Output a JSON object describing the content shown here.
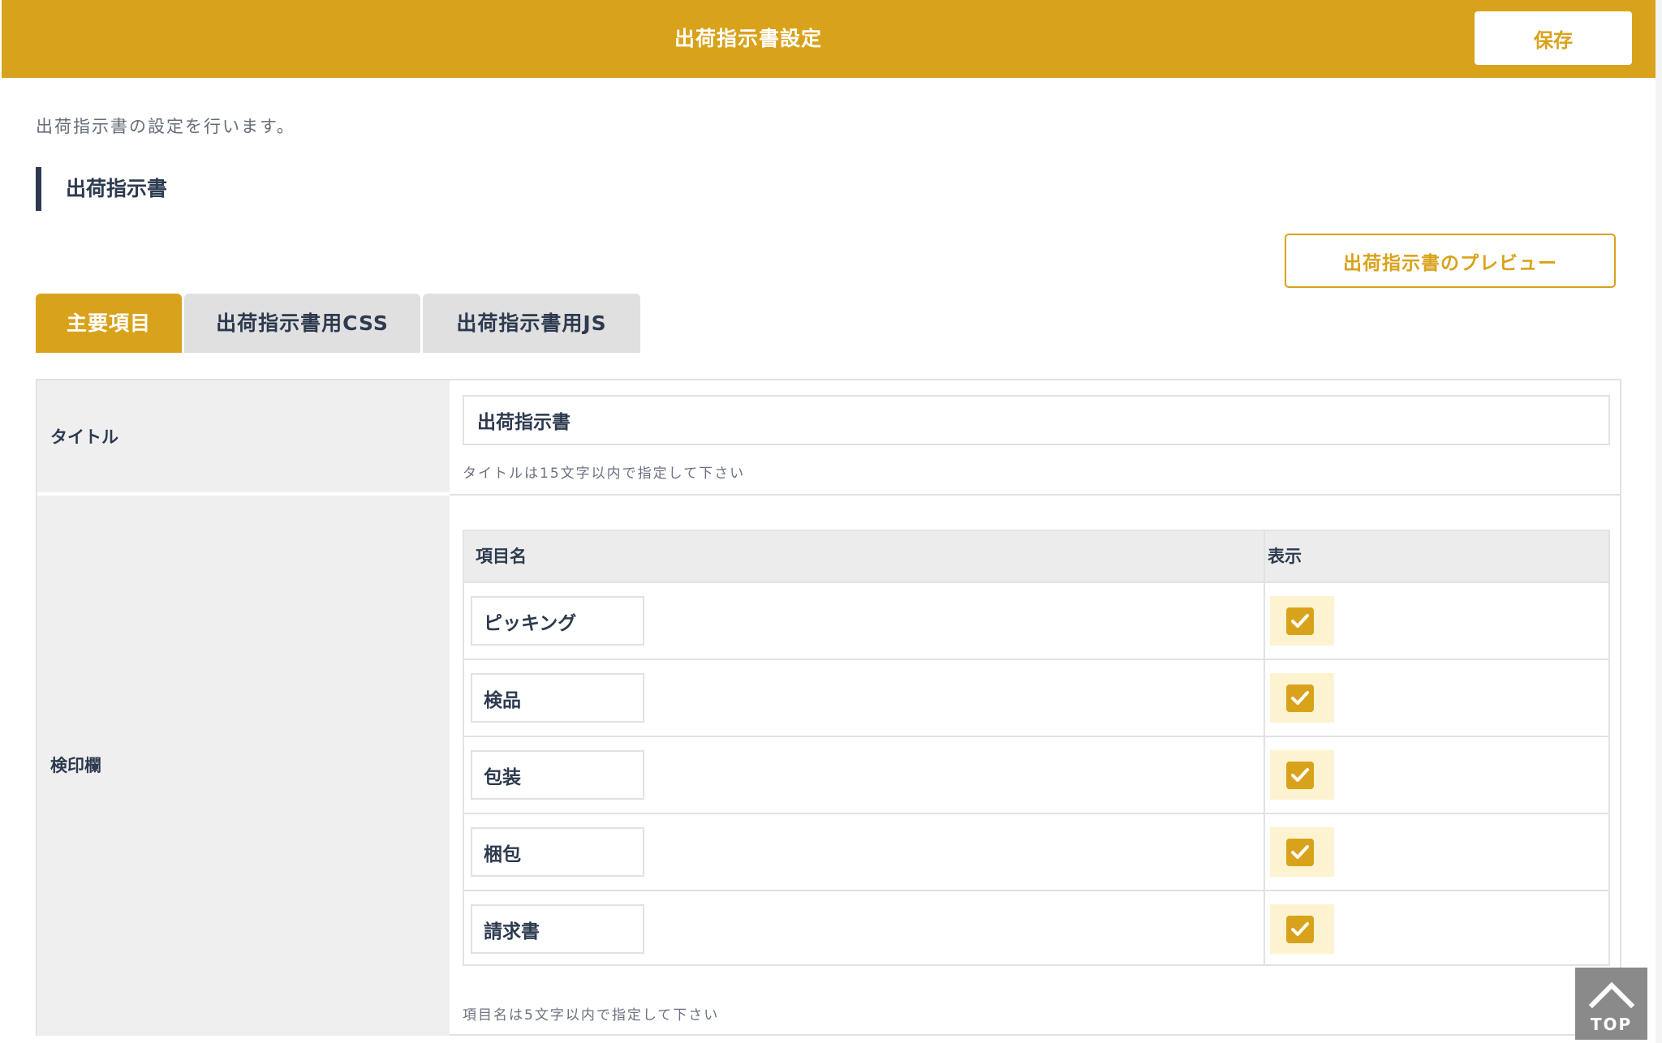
{
  "header": {
    "title": "出荷指示書設定",
    "save_label": "保存",
    "accent_color": "#d9a21b"
  },
  "description": "出荷指示書の設定を行います。",
  "section_title": "出荷指示書",
  "preview_label": "出荷指示書のプレビュー",
  "tabs": [
    {
      "label": "主要項目",
      "active": true
    },
    {
      "label": "出荷指示書用CSS",
      "active": false
    },
    {
      "label": "出荷指示書用JS",
      "active": false
    }
  ],
  "form": {
    "title_label": "タイトル",
    "title_value": "出荷指示書",
    "title_hint": "タイトルは15文字以内で指定して下さい",
    "kenin_label": "検印欄",
    "items_header": {
      "name": "項目名",
      "show": "表示"
    },
    "items": [
      {
        "name": "ピッキング",
        "checked": true
      },
      {
        "name": "検品",
        "checked": true
      },
      {
        "name": "包装",
        "checked": true
      },
      {
        "name": "梱包",
        "checked": true
      },
      {
        "name": "請求書",
        "checked": true
      }
    ],
    "items_hint": "項目名は5文字以内で指定して下さい"
  },
  "top_button": {
    "label": "TOP",
    "icon": "chevron-up-icon"
  }
}
